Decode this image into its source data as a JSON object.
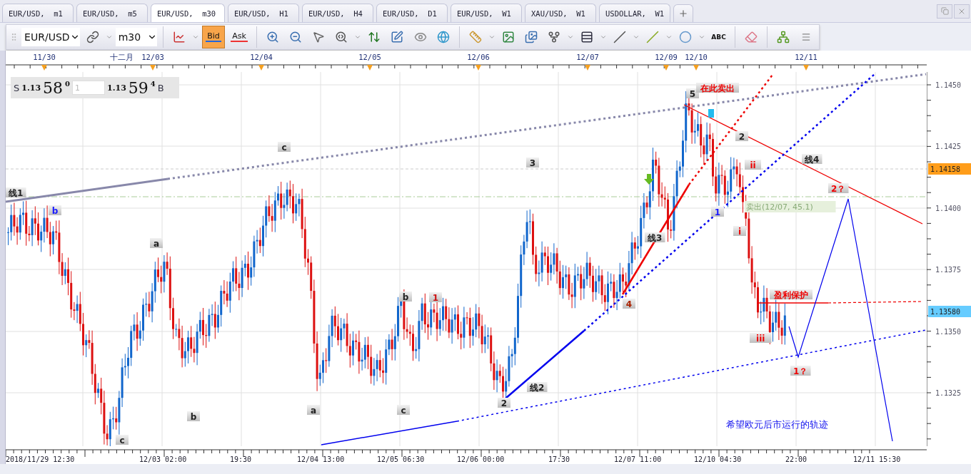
{
  "tabs": [
    {
      "label": "EUR/USD,  m1",
      "selected": false
    },
    {
      "label": "EUR/USD,  m5",
      "selected": false
    },
    {
      "label": "EUR/USD,  m30",
      "selected": true
    },
    {
      "label": "EUR/USD,  H1",
      "selected": false
    },
    {
      "label": "EUR/USD,  H4",
      "selected": false
    },
    {
      "label": "EUR/USD,  D1",
      "selected": false
    },
    {
      "label": "EUR/USD,  W1",
      "selected": false
    },
    {
      "label": "XAU/USD,  W1",
      "selected": false
    },
    {
      "label": "USDOLLAR,  W1",
      "selected": false
    }
  ],
  "toolbar": {
    "symbol": "EUR/USD",
    "timeframe": "m30",
    "text_tool": "ABC",
    "price_modes": [
      {
        "label": "Bid",
        "selected": true
      },
      {
        "label": "Ask",
        "selected": false
      }
    ]
  },
  "quote": {
    "sell_label": "S",
    "sell_big": "1.13",
    "sell_pips": "58",
    "sell_fraction": "0",
    "amount": "1",
    "buy_big": "1.13",
    "buy_pips": "59",
    "buy_fraction": "4",
    "buy_label": "B"
  },
  "top_axis": [
    "11/30",
    "十二月",
    "12/03",
    "12/04",
    "12/05",
    "12/06",
    "12/07",
    "12/09",
    "12/10",
    "12/11"
  ],
  "bottom_axis": [
    "2018/11/29 12:30",
    "12/03 02:00",
    "19:30",
    "12/04 13:00",
    "12/05 06:30",
    "12/06 00:00",
    "17:30",
    "12/07 11:00",
    "12/10 04:30",
    "22:00",
    "12/11 15:30"
  ],
  "price_axis": [
    {
      "label": "1.1450",
      "kind": "tick"
    },
    {
      "label": "1.1425",
      "kind": "tick"
    },
    {
      "label": "1.14158",
      "kind": "marker",
      "color": "#ff9d1a"
    },
    {
      "label": "1.1400",
      "kind": "tick"
    },
    {
      "label": "1.1375",
      "kind": "tick"
    },
    {
      "label": "1.13580",
      "kind": "marker",
      "color": "#66ccff"
    },
    {
      "label": "1.1350",
      "kind": "tick"
    },
    {
      "label": "1.1325",
      "kind": "tick"
    }
  ],
  "annotations": [
    {
      "text": "线1",
      "color": "#222222"
    },
    {
      "text": "b",
      "color": "#1a1aff"
    },
    {
      "text": "a",
      "color": "#222222"
    },
    {
      "text": "b",
      "color": "#222222"
    },
    {
      "text": "c",
      "color": "#222222"
    },
    {
      "text": "a",
      "color": "#222222"
    },
    {
      "text": "c",
      "color": "#222222"
    },
    {
      "text": "b",
      "color": "#222222"
    },
    {
      "text": "c",
      "color": "#222222"
    },
    {
      "text": "1",
      "color": "#cc1111"
    },
    {
      "text": "3",
      "color": "#222222"
    },
    {
      "text": "线2",
      "color": "#222222"
    },
    {
      "text": "2",
      "color": "#222222"
    },
    {
      "text": "线3",
      "color": "#222222"
    },
    {
      "text": "4",
      "color": "#aa2200"
    },
    {
      "text": "5",
      "color": "#222222"
    },
    {
      "text": "在此卖出",
      "color": "#ee0000"
    },
    {
      "text": "2",
      "color": "#222222"
    },
    {
      "text": "ii",
      "color": "#ee0000"
    },
    {
      "text": "线4",
      "color": "#222222"
    },
    {
      "text": "2？",
      "color": "#ee0000"
    },
    {
      "text": "1",
      "color": "#1a1aff"
    },
    {
      "text": "i",
      "color": "#ee0000"
    },
    {
      "text": "盈利保护",
      "color": "#ee0000"
    },
    {
      "text": "iii",
      "color": "#ee0000"
    },
    {
      "text": "1？",
      "color": "#ee0000"
    }
  ],
  "order_label": "卖出(12/07, 45.1)",
  "forecast_caption": "希望欧元后市运行的轨迹"
}
